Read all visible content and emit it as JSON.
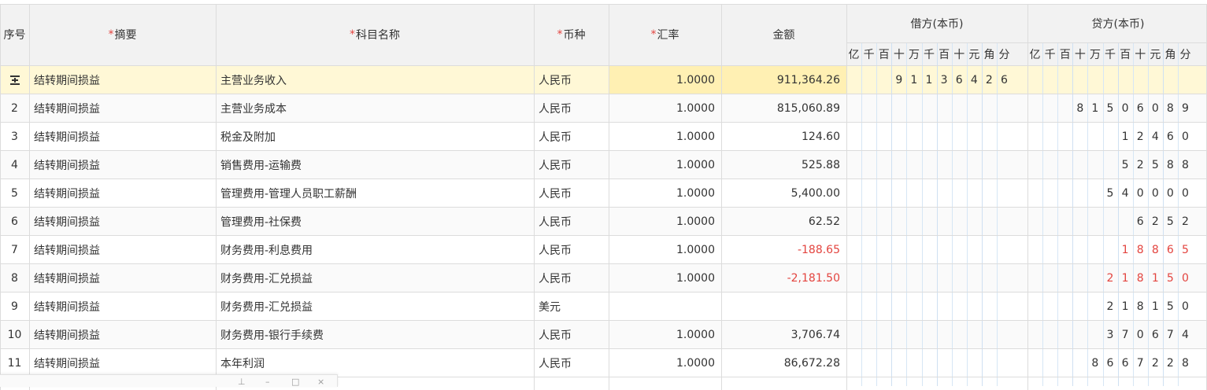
{
  "header": {
    "seq": "序号",
    "summary": "摘要",
    "account": "科目名称",
    "currency": "币种",
    "rate": "汇率",
    "amount": "金额",
    "debit": "借方(本币)",
    "credit": "贷方(本币)",
    "units": [
      "亿",
      "千",
      "百",
      "十",
      "万",
      "千",
      "百",
      "十",
      "元",
      "角",
      "分"
    ],
    "required_mark": "*"
  },
  "rows": [
    {
      "seq": "",
      "summary": "结转期间损益",
      "account": "主营业务收入",
      "currency": "人民币",
      "rate": "1.0000",
      "amount": "911,364.26",
      "debit": "91136426",
      "credit": "",
      "negative": false,
      "highlight": true
    },
    {
      "seq": "2",
      "summary": "结转期间损益",
      "account": "主营业务成本",
      "currency": "人民币",
      "rate": "1.0000",
      "amount": "815,060.89",
      "debit": "",
      "credit": "81506089",
      "negative": false
    },
    {
      "seq": "3",
      "summary": "结转期间损益",
      "account": "税金及附加",
      "currency": "人民币",
      "rate": "1.0000",
      "amount": "124.60",
      "debit": "",
      "credit": "12460",
      "negative": false
    },
    {
      "seq": "4",
      "summary": "结转期间损益",
      "account": "销售费用-运输费",
      "currency": "人民币",
      "rate": "1.0000",
      "amount": "525.88",
      "debit": "",
      "credit": "52588",
      "negative": false
    },
    {
      "seq": "5",
      "summary": "结转期间损益",
      "account": "管理费用-管理人员职工薪酬",
      "currency": "人民币",
      "rate": "1.0000",
      "amount": "5,400.00",
      "debit": "",
      "credit": "540000",
      "negative": false
    },
    {
      "seq": "6",
      "summary": "结转期间损益",
      "account": "管理费用-社保费",
      "currency": "人民币",
      "rate": "1.0000",
      "amount": "62.52",
      "debit": "",
      "credit": "6252",
      "negative": false
    },
    {
      "seq": "7",
      "summary": "结转期间损益",
      "account": "财务费用-利息费用",
      "currency": "人民币",
      "rate": "1.0000",
      "amount": "-188.65",
      "debit": "",
      "credit": "18865",
      "negative": true
    },
    {
      "seq": "8",
      "summary": "结转期间损益",
      "account": "财务费用-汇兑损益",
      "currency": "人民币",
      "rate": "1.0000",
      "amount": "-2,181.50",
      "debit": "",
      "credit": "218150",
      "negative": true
    },
    {
      "seq": "9",
      "summary": "结转期间损益",
      "account": "财务费用-汇兑损益",
      "currency": "美元",
      "rate": "",
      "amount": "",
      "debit": "",
      "credit": "218150",
      "negative": false
    },
    {
      "seq": "10",
      "summary": "结转期间损益",
      "account": "财务费用-银行手续费",
      "currency": "人民币",
      "rate": "1.0000",
      "amount": "3,706.74",
      "debit": "",
      "credit": "370674",
      "negative": false
    },
    {
      "seq": "11",
      "summary": "结转期间损益",
      "account": "本年利润",
      "currency": "人民币",
      "rate": "1.0000",
      "amount": "86,672.28",
      "debit": "",
      "credit": "8667228",
      "negative": false
    }
  ],
  "colors": {
    "header_bg": "#f2f2f2",
    "highlight_row": "#fff8d6",
    "highlight_rate": "#fff0b3",
    "negative": "#e3443f",
    "required": "#e3443f"
  },
  "icons": {
    "row_insert": "insert-row-icon",
    "toolbar": [
      "pin-icon",
      "minimize-icon",
      "maximize-icon",
      "close-icon"
    ]
  },
  "toolbar_glyphs": [
    "⊥",
    "–",
    "□",
    "×"
  ]
}
